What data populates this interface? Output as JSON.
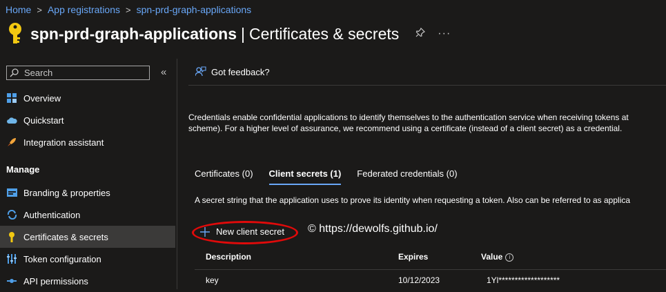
{
  "breadcrumb": {
    "items": [
      "Home",
      "App registrations",
      "spn-prd-graph-applications"
    ],
    "separator": ">"
  },
  "header": {
    "app_name": "spn-prd-graph-applications",
    "separator": "|",
    "page_title": "Certificates & secrets",
    "pin_icon": "pin-icon",
    "more": "···"
  },
  "search": {
    "placeholder": "Search",
    "collapse": "«"
  },
  "sidebar": {
    "items": [
      {
        "label": "Overview",
        "icon": "overview-icon",
        "color": "#4f9fe8"
      },
      {
        "label": "Quickstart",
        "icon": "cloud-icon",
        "color": "#6fb5e8"
      },
      {
        "label": "Integration assistant",
        "icon": "rocket-icon",
        "color": "#f2a43a"
      }
    ],
    "section": "Manage",
    "manage_items": [
      {
        "label": "Branding & properties",
        "icon": "branding-icon",
        "color": "#4f9fe8"
      },
      {
        "label": "Authentication",
        "icon": "authentication-icon",
        "color": "#4f9fe8"
      },
      {
        "label": "Certificates & secrets",
        "icon": "key-icon",
        "color": "#f2c811",
        "active": true
      },
      {
        "label": "Token configuration",
        "icon": "token-icon",
        "color": "#4f9fe8"
      },
      {
        "label": "API permissions",
        "icon": "api-icon",
        "color": "#4f9fe8"
      }
    ]
  },
  "toolbar": {
    "feedback_label": "Got feedback?"
  },
  "main": {
    "description_line1": "Credentials enable confidential applications to identify themselves to the authentication service when receiving tokens at",
    "description_line2": "scheme). For a higher level of assurance, we recommend using a certificate (instead of a client secret) as a credential.",
    "tabs": [
      {
        "label": "Certificates (0)"
      },
      {
        "label": "Client secrets (1)",
        "active": true
      },
      {
        "label": "Federated credentials (0)"
      }
    ],
    "tab_description": "A secret string that the application uses to prove its identity when requesting a token. Also can be referred to as applica",
    "new_secret_label": "New client secret",
    "copyright": "© https://dewolfs.github.io/",
    "table": {
      "headers": {
        "description": "Description",
        "expires": "Expires",
        "value": "Value"
      },
      "rows": [
        {
          "description": "key",
          "expires": "10/12/2023",
          "value": "1Yl*******************"
        }
      ]
    }
  },
  "colors": {
    "accent": "#69a7f7",
    "highlight": "#e00a0a",
    "key": "#f2c811"
  }
}
